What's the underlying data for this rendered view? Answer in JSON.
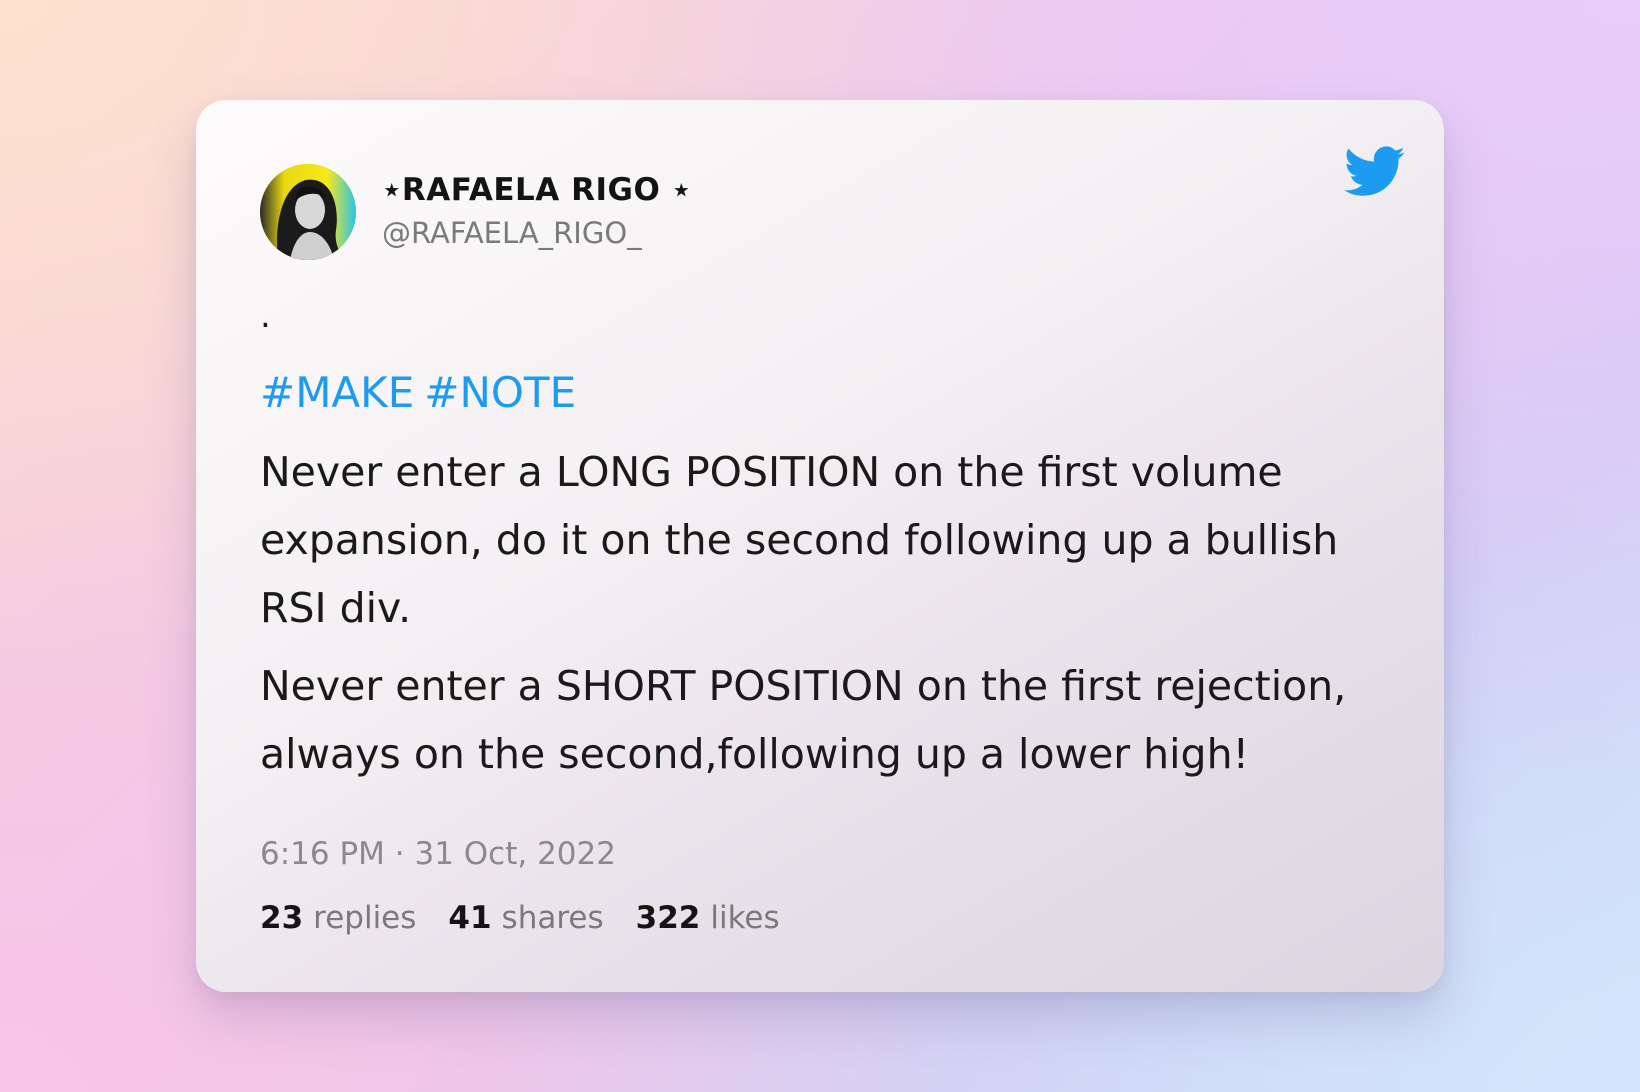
{
  "tweet": {
    "author": {
      "display_name": "⋆RAFAELA RIGO ⋆",
      "handle": "@RAFAELA_RIGO_"
    },
    "first_line": ".",
    "hashtags": [
      "#MAKE",
      "#NOTE"
    ],
    "paragraphs": [
      "Never enter a LONG POSITION on the first volume expansion, do it on the second following up a bullish RSI div.",
      "Never enter a SHORT POSITION on the first rejection, always on the second,following up a lower high!"
    ],
    "timestamp": "6:16 PM · 31 Oct, 2022",
    "stats": {
      "replies_count": "23",
      "replies_label": "replies",
      "shares_count": "41",
      "shares_label": "shares",
      "likes_count": "322",
      "likes_label": "likes"
    }
  },
  "icons": {
    "brand": "twitter-bird-icon",
    "avatar": "profile-photo"
  },
  "colors": {
    "hashtag": "#1d9bf0",
    "twitter_brand": "#1d9bf0",
    "text": "#1a1a1a",
    "muted": "#7a7a7a"
  }
}
